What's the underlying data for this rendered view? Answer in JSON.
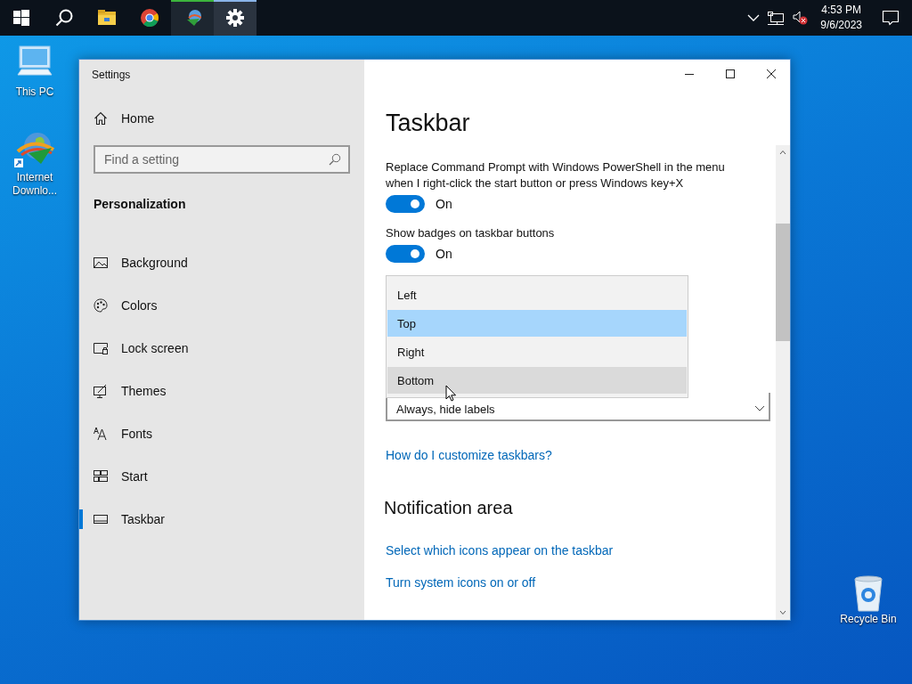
{
  "taskbar": {
    "items": [
      {
        "kind": "start",
        "open": false,
        "selected": false
      },
      {
        "kind": "search",
        "open": false,
        "selected": false
      },
      {
        "kind": "explorer",
        "open": false,
        "selected": false
      },
      {
        "kind": "chrome",
        "open": false,
        "selected": false
      },
      {
        "kind": "downloader",
        "open": true,
        "selected": false,
        "color": "#3cb43c"
      },
      {
        "kind": "settings",
        "open": true,
        "selected": true,
        "color": "#8ab4e8"
      }
    ],
    "tray": {
      "time": "4:53 PM",
      "date": "9/6/2023"
    }
  },
  "desktop_icons": [
    {
      "kind": "pc",
      "label": "This PC"
    },
    {
      "kind": "downloader",
      "label": "Internet Downlo..."
    },
    {
      "kind": "recycle",
      "label": "Recycle Bin"
    }
  ],
  "window": {
    "title": "Settings"
  },
  "sidebar": {
    "home": "Home",
    "search": {
      "placeholder": "Find a setting"
    },
    "section": "Personalization",
    "items": [
      {
        "kind": "background",
        "label": "Background",
        "selected": false
      },
      {
        "kind": "colors",
        "label": "Colors",
        "selected": false
      },
      {
        "kind": "lock",
        "label": "Lock screen",
        "selected": false
      },
      {
        "kind": "themes",
        "label": "Themes",
        "selected": false
      },
      {
        "kind": "fonts",
        "label": "Fonts",
        "selected": false
      },
      {
        "kind": "start",
        "label": "Start",
        "selected": false
      },
      {
        "kind": "taskbar",
        "label": "Taskbar",
        "selected": true
      }
    ]
  },
  "content": {
    "heading": "Taskbar",
    "toggles": [
      {
        "label": "Replace Command Prompt with Windows PowerShell in the menu when I right-click the start button or press Windows key+X",
        "on": true,
        "state_text": "On"
      },
      {
        "label": "Show badges on taskbar buttons",
        "on": true,
        "state_text": "On"
      }
    ],
    "dropdown_options": [
      {
        "label": "Left",
        "selected": false,
        "hovered": false
      },
      {
        "label": "Top",
        "selected": true,
        "hovered": false
      },
      {
        "label": "Right",
        "selected": false,
        "hovered": false
      },
      {
        "label": "Bottom",
        "selected": false,
        "hovered": true
      }
    ],
    "combine_value": "Always, hide labels",
    "help_link": "How do I customize taskbars?",
    "section": "Notification area",
    "links": [
      "Select which icons appear on the taskbar",
      "Turn system icons on or off"
    ]
  }
}
